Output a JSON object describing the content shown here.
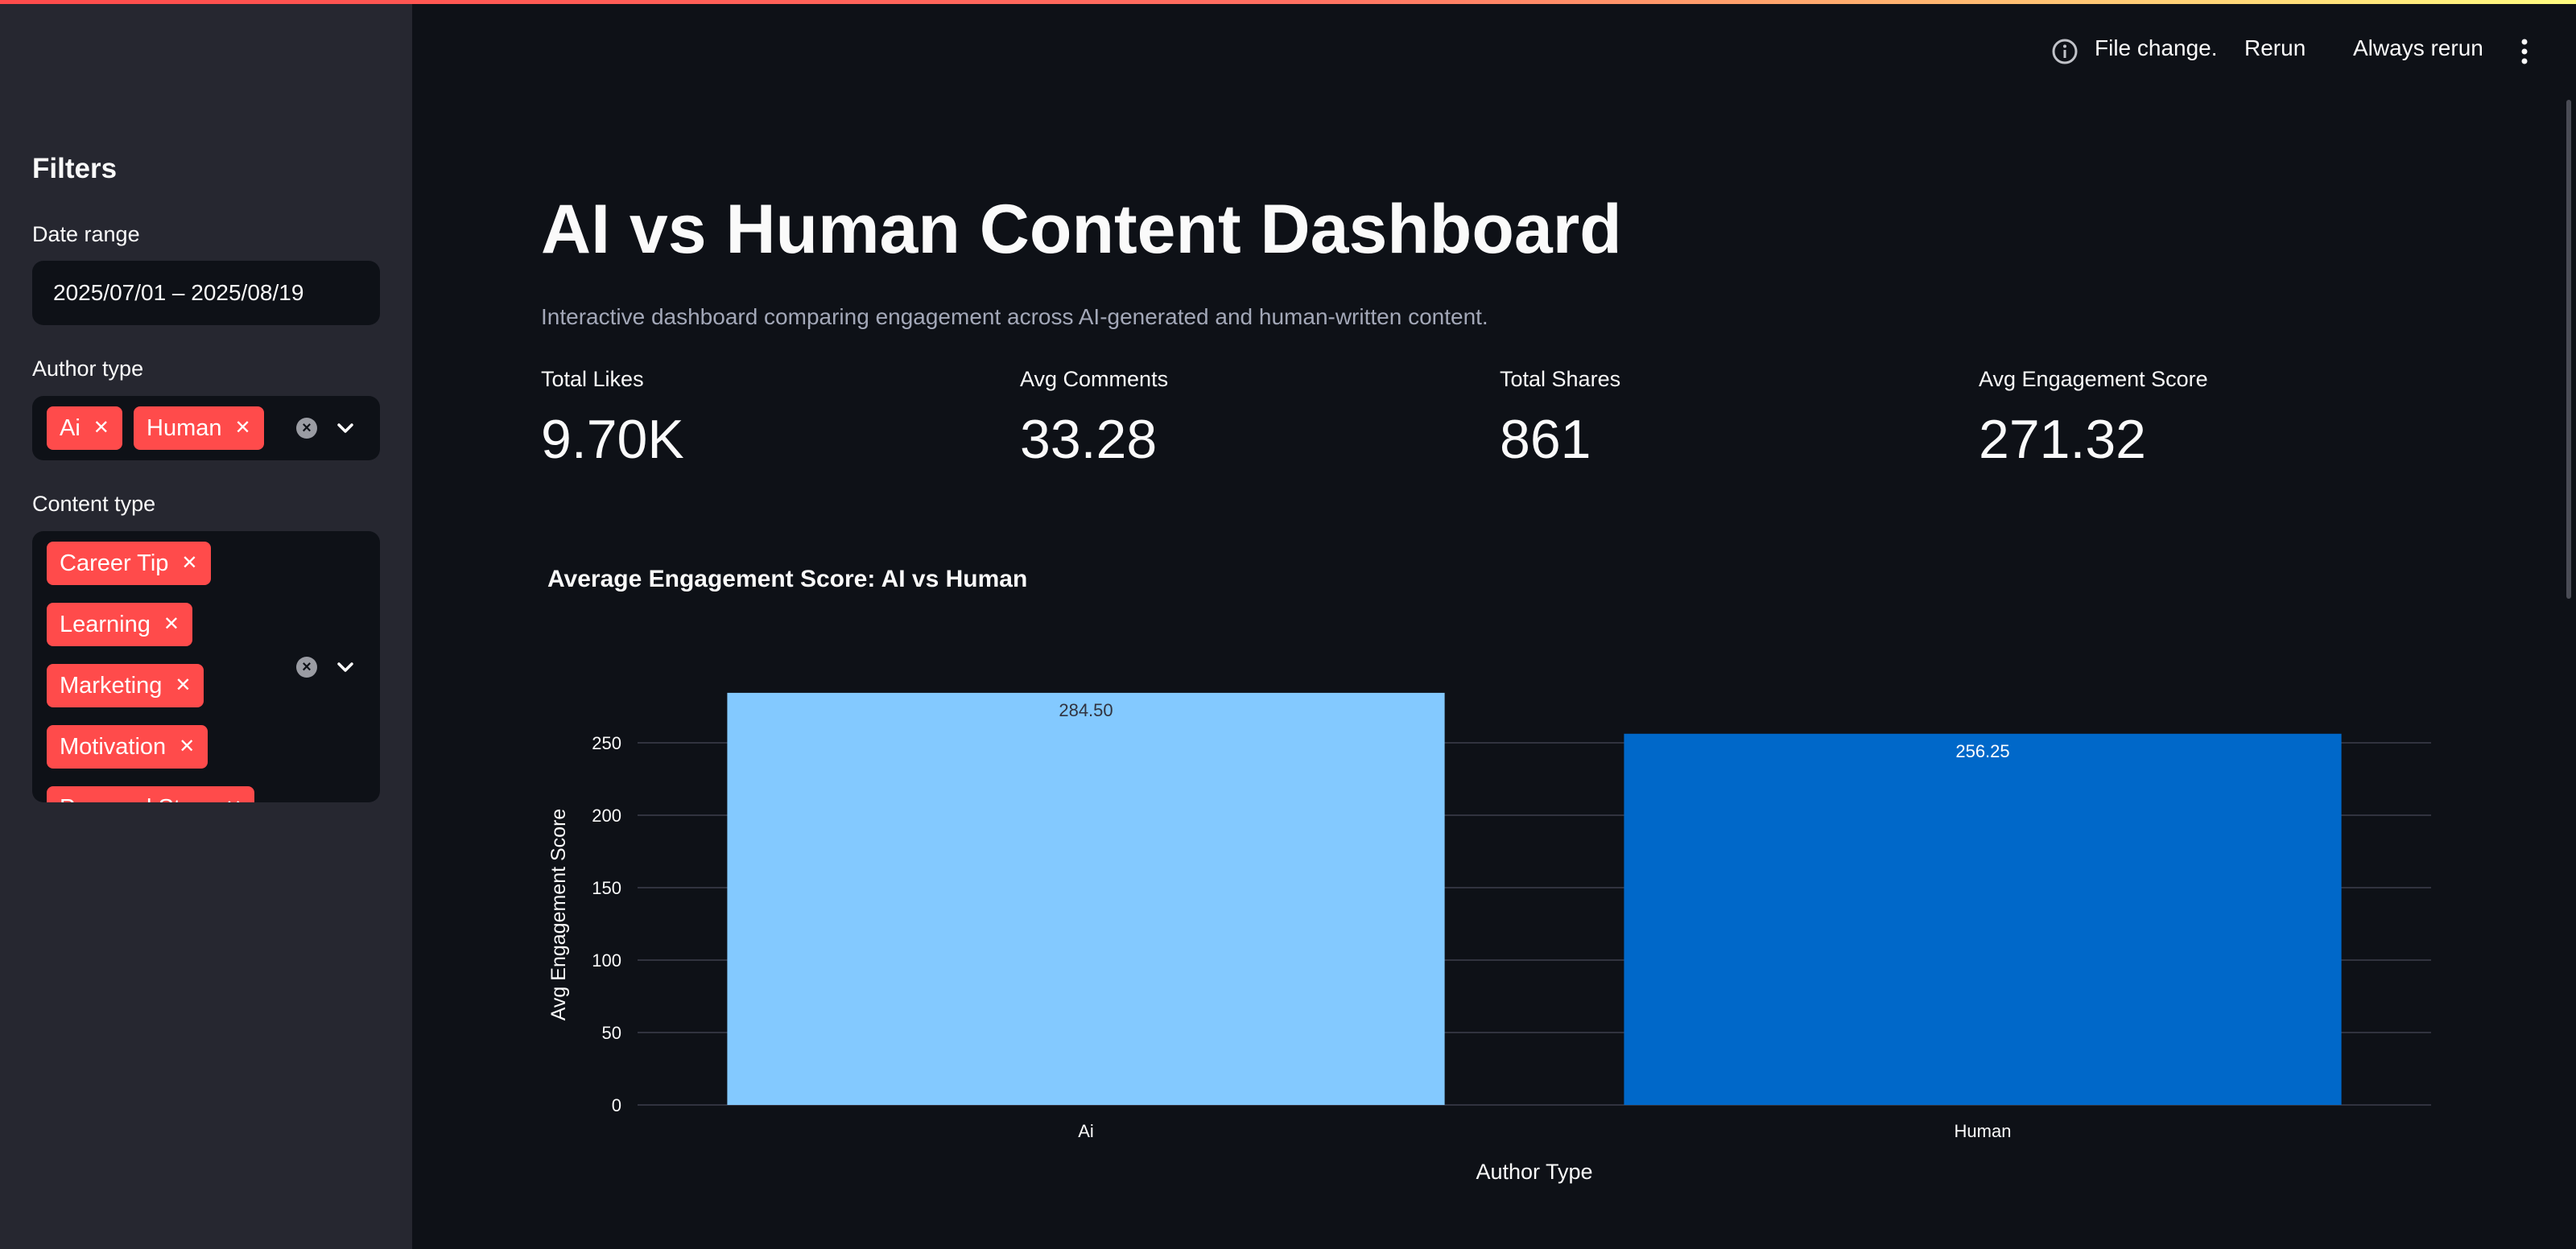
{
  "header": {
    "status_text": "File change.",
    "rerun_label": "Rerun",
    "always_rerun_label": "Always rerun",
    "info_icon": "info-icon",
    "menu_icon": "kebab-menu-icon"
  },
  "sidebar": {
    "title": "Filters",
    "date_range": {
      "label": "Date range",
      "value": "2025/07/01 – 2025/08/19"
    },
    "author_type": {
      "label": "Author type",
      "selected": [
        "Ai",
        "Human"
      ]
    },
    "content_type": {
      "label": "Content type",
      "selected": [
        "Career Tip",
        "Learning",
        "Marketing",
        "Motivation",
        "Personal Story"
      ]
    }
  },
  "main": {
    "title": "AI vs Human Content Dashboard",
    "subtitle": "Interactive dashboard comparing engagement across AI-generated and human-written content.",
    "metrics": [
      {
        "label": "Total Likes",
        "value": "9.70K"
      },
      {
        "label": "Avg Comments",
        "value": "33.28"
      },
      {
        "label": "Total Shares",
        "value": "861"
      },
      {
        "label": "Avg Engagement Score",
        "value": "271.32"
      }
    ]
  },
  "colors": {
    "accent": "#ff4b4b",
    "background": "#0e1117",
    "sidebar": "#262730",
    "bar_ai": "#83c9ff",
    "bar_human": "#0068c9"
  },
  "chart_data": {
    "type": "bar",
    "title": "Average Engagement Score: AI vs Human",
    "categories": [
      "Ai",
      "Human"
    ],
    "values": [
      284.5,
      256.25
    ],
    "data_labels": [
      "284.50",
      "256.25"
    ],
    "xlabel": "Author Type",
    "ylabel": "Avg Engagement Score",
    "ylim": [
      0,
      285
    ],
    "yticks": [
      0,
      50,
      100,
      150,
      200,
      250
    ],
    "grid": true
  }
}
